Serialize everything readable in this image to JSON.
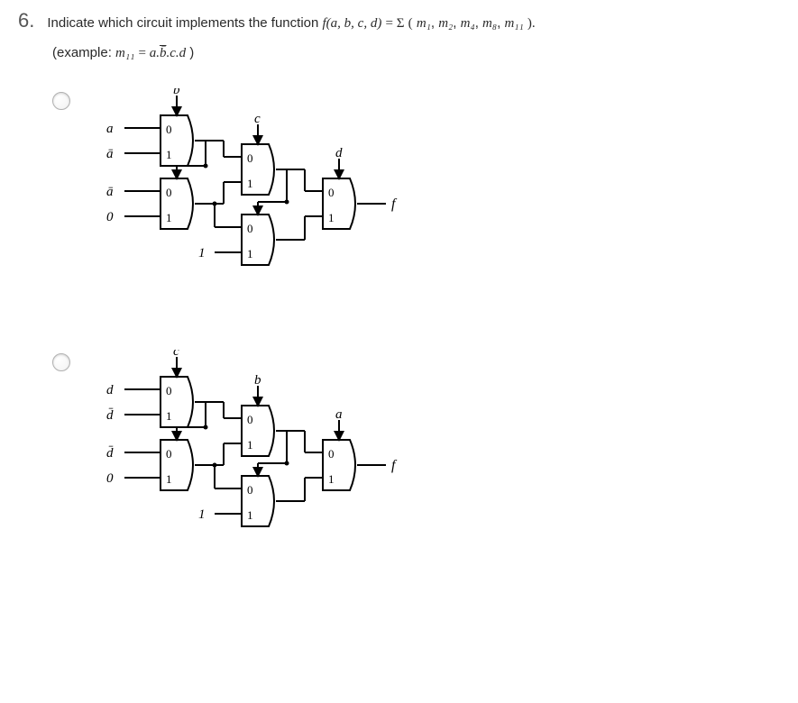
{
  "question": {
    "number": "6.",
    "prompt_prefix": "Indicate which circuit implements the function ",
    "function_lhs": "f(a, b, c, d)",
    "function_eq": " = ",
    "function_sigma": "Σ",
    "function_args_open": "(",
    "function_args_close": ").",
    "minterms": [
      "m₁",
      "m₂",
      "m₄",
      "m₈",
      "m₁₁"
    ],
    "example_prefix": "(example: ",
    "example_m": "m₁₁",
    "example_mid": " = ",
    "example_expr_a": "a",
    "example_expr_bbar": "b̄",
    "example_expr_c": "c",
    "example_expr_d": "d",
    "example_suffix": ")"
  },
  "circuitA": {
    "stage1_sel": "b",
    "stage1_mux1_in0": "a",
    "stage1_mux1_in1": "ā",
    "stage1_mux2_in0": "ā",
    "stage1_mux2_in1": "0",
    "stage2_sel": "c",
    "stage2_mux2_in1": "1",
    "stage3_sel": "d",
    "out": "f"
  },
  "circuitB": {
    "stage1_sel": "c",
    "stage1_mux1_in0": "d",
    "stage1_mux1_in1": "d̄",
    "stage1_mux2_in0": "d̄",
    "stage1_mux2_in1": "0",
    "stage2_sel": "b",
    "stage2_mux2_in1": "1",
    "stage3_sel": "a",
    "out": "f"
  }
}
